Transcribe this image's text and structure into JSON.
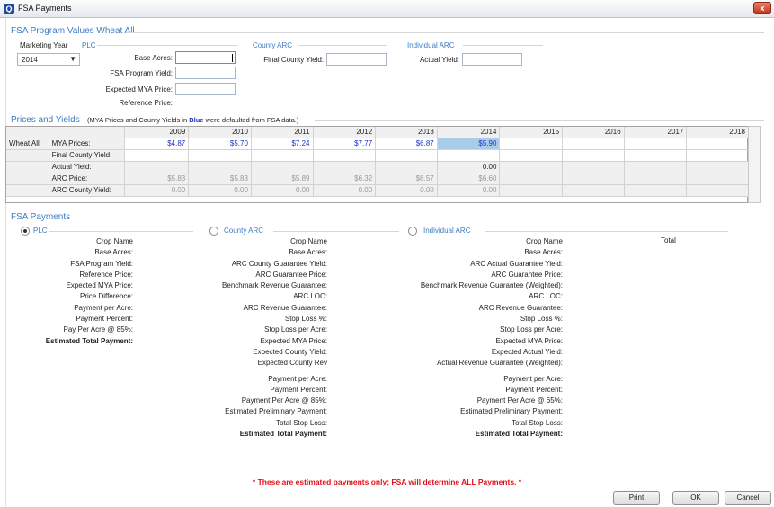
{
  "window": {
    "title": "FSA Payments",
    "icon_letter": "Q",
    "close_label": "x"
  },
  "program_values": {
    "title": "FSA Program Values Wheat All",
    "marketing_year_label": "Marketing Year",
    "marketing_year_value": "2014",
    "plc": {
      "title": "PLC",
      "base_acres_label": "Base Acres:",
      "base_acres_value": "",
      "fsa_program_yield_label": "FSA Program Yield:",
      "fsa_program_yield_value": "",
      "expected_mya_price_label": "Expected MYA Price:",
      "expected_mya_price_value": "",
      "reference_price_label": "Reference Price:"
    },
    "county_arc": {
      "title": "County ARC",
      "final_county_yield_label": "Final County Yield:",
      "final_county_yield_value": ""
    },
    "individual_arc": {
      "title": "Individual ARC",
      "actual_yield_label": "Actual Yield:",
      "actual_yield_value": ""
    }
  },
  "prices_yields": {
    "title": "Prices and Yields",
    "note_prefix": "(MYA Prices and County Yields in ",
    "note_blue": "Blue",
    "note_suffix": " were defaulted from FSA data.)",
    "crop": "Wheat All",
    "years": [
      "2009",
      "2010",
      "2011",
      "2012",
      "2013",
      "2014",
      "2015",
      "2016",
      "2017",
      "2018"
    ],
    "rows": [
      {
        "label": "MYA Prices:",
        "values": [
          "$4.87",
          "$5.70",
          "$7.24",
          "$7.77",
          "$6.87",
          "$5.90",
          "",
          "",
          "",
          ""
        ]
      },
      {
        "label": "Final County Yield:",
        "values": [
          "",
          "",
          "",
          "",
          "",
          "",
          "",
          "",
          "",
          ""
        ]
      },
      {
        "label": "Actual Yield:",
        "values": [
          "",
          "",
          "",
          "",
          "",
          "0.00",
          "",
          "",
          "",
          ""
        ]
      },
      {
        "label": "ARC Price:",
        "values": [
          "$5.83",
          "$5.83",
          "$5.89",
          "$6.32",
          "$6.57",
          "$6.60",
          "",
          "",
          "",
          ""
        ]
      },
      {
        "label": "ARC County Yield:",
        "values": [
          "0.00",
          "0.00",
          "0.00",
          "0.00",
          "0.00",
          "0.00",
          "",
          "",
          "",
          ""
        ]
      }
    ]
  },
  "fsa_payments": {
    "title": "FSA Payments",
    "options": [
      "PLC",
      "County ARC",
      "Individual ARC"
    ],
    "selected": "PLC",
    "plc_labels": [
      "Crop Name",
      "Base Acres:",
      "FSA Program Yield:",
      "Reference Price:",
      "Expected MYA Price:",
      "Price Difference:",
      "Payment per Acre:",
      "Payment Percent:",
      "Pay Per Acre @ 85%:",
      "Estimated Total Payment:"
    ],
    "county_labels": [
      "Crop Name",
      "Base Acres:",
      "ARC County Guarantee Yield:",
      "ARC Guarantee Price:",
      "Benchmark Revenue Guarantee:",
      "ARC LOC:",
      "ARC Revenue Guarantee:",
      "Stop Loss %:",
      "Stop Loss per Acre:",
      "Expected MYA Price:",
      "Expected County Yield:",
      "Expected County Rev",
      "Payment per Acre:",
      "Payment Percent:",
      "Payment Per Acre @ 85%:",
      "Estimated Preliminary Payment:",
      "Total Stop Loss:",
      "Estimated Total Payment:"
    ],
    "individual_labels": [
      "Crop Name",
      "Base Acres:",
      "ARC Actual Guarantee Yield:",
      "ARC Guarantee Price:",
      "Benchmark Revenue Guarantee (Weighted):",
      "ARC LOC:",
      "ARC Revenue Guarantee:",
      "Stop Loss %:",
      "Stop Loss per Acre:",
      "Expected MYA Price:",
      "Expected Actual Yield:",
      "Actual Revenue Guarantee (Weighted):",
      "Payment per Acre:",
      "Payment Percent:",
      "Payment Per Acre @ 65%:",
      "Estimated Preliminary Payment:",
      "Total Stop Loss:",
      "Estimated Total Payment:"
    ],
    "total_label": "Total"
  },
  "disclaimer": "* These are estimated payments only;  FSA will determine ALL Payments. *",
  "buttons": {
    "print": "Print",
    "ok": "OK",
    "cancel": "Cancel"
  },
  "colors": {
    "section_title": "#3b7dc4",
    "blue_value": "#1a33c9",
    "disclaimer": "#e3101a",
    "selected_cell": "#a9cde8"
  }
}
